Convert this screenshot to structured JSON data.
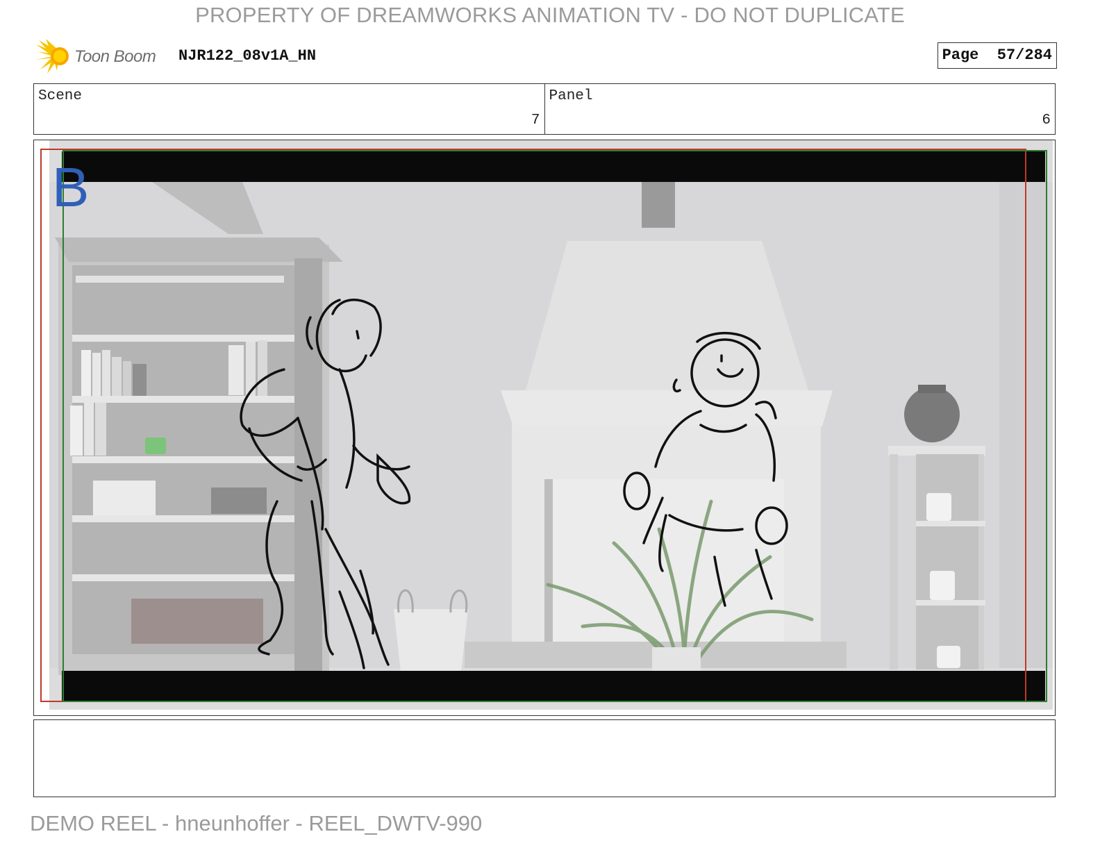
{
  "watermark_top": "PROPERTY OF DREAMWORKS ANIMATION TV - DO NOT DUPLICATE",
  "header": {
    "logo_text": "Toon Boom",
    "project_id": "NJR122_08v1A_HN",
    "page_label": "Page",
    "page_number": "57/284"
  },
  "info": {
    "scene_label": "Scene",
    "scene_value": "7",
    "panel_label": "Panel",
    "panel_value": "6"
  },
  "panel": {
    "letter": "B",
    "colors": {
      "action_safe": "#c0392b",
      "title_safe": "#2e7d32",
      "letterbox": "#0a0a0a",
      "background": "#dcdcdc",
      "letter": "#2f5fb8"
    }
  },
  "notes": "",
  "watermark_bottom": "DEMO REEL - hneunhoffer - REEL_DWTV-990"
}
